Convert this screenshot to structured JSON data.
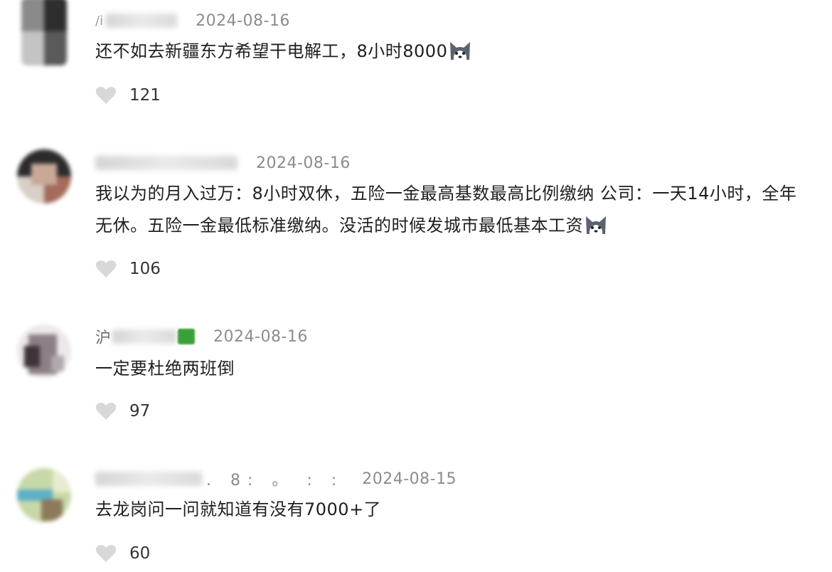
{
  "comments": [
    {
      "name_visible": "/i",
      "name_extra": "",
      "date": "2024-08-16",
      "text": "还不如去新疆东方希望干电解工，8小时8000",
      "emoji": "husky-emoji",
      "likes": "121",
      "avatar_colors": [
        "#6e6e6e",
        "#2d2d2d",
        "#bdbdbd",
        "#9c9c9c"
      ]
    },
    {
      "name_visible": "",
      "name_extra": "",
      "date": "2024-08-16",
      "text": "我以为的月入过万：8小时双休，五险一金最高基数最高比例缴纳 公司：一天14小时，全年无休。五险一金最低标准缴纳。没活的时候发城市最低基本工资",
      "emoji": "husky-emoji",
      "likes": "106",
      "avatar_colors": [
        "#2b2b2b",
        "#d8cfc6",
        "#a56b5b",
        "#e9e9e9"
      ]
    },
    {
      "name_visible": "沪",
      "name_extra": "",
      "date": "2024-08-16",
      "text": "一定要杜绝两班倒",
      "emoji": "",
      "likes": "97",
      "avatar_colors": [
        "#d9d3d6",
        "#8d7f86",
        "#f0eeee",
        "#b1a9ad"
      ]
    },
    {
      "name_visible": "",
      "name_extra": ". 8: 。 : :",
      "date": "2024-08-15",
      "text": "去龙岗问一问就知道有没有7000+了",
      "emoji": "",
      "likes": "60",
      "avatar_colors": [
        "#c8d8a8",
        "#5fb0c4",
        "#8c7a5a",
        "#e6eccd"
      ]
    }
  ],
  "colors": {
    "date": "#8c8c8c",
    "heart": "#d8d8d8",
    "badge_green": "#3aa13a"
  }
}
